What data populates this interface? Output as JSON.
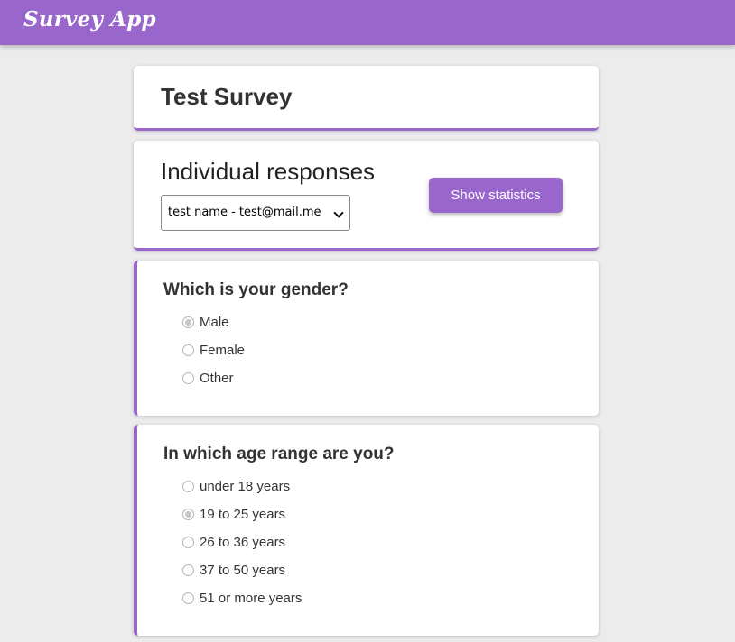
{
  "app": {
    "brand": "Survey App"
  },
  "survey": {
    "title": "Test Survey"
  },
  "responses": {
    "heading": "Individual responses",
    "selected_respondent": "test name - test@mail.me",
    "stats_button": "Show statistics"
  },
  "questions": [
    {
      "text": "Which is your gender?",
      "options": [
        {
          "label": "Male",
          "checked": true
        },
        {
          "label": "Female",
          "checked": false
        },
        {
          "label": "Other",
          "checked": false
        }
      ]
    },
    {
      "text": "In which age range are you?",
      "options": [
        {
          "label": "under 18 years",
          "checked": false
        },
        {
          "label": "19 to 25 years",
          "checked": true
        },
        {
          "label": "26 to 36 years",
          "checked": false
        },
        {
          "label": "37 to 50 years",
          "checked": false
        },
        {
          "label": "51 or more years",
          "checked": false
        }
      ]
    }
  ],
  "colors": {
    "accent": "#9966cc",
    "background": "#ececec",
    "card": "#ffffff"
  }
}
